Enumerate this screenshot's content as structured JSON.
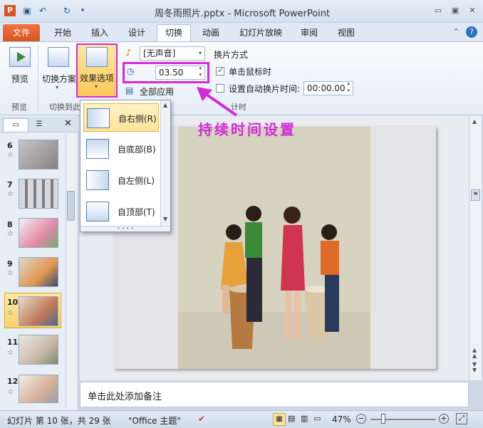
{
  "window": {
    "title": "周冬雨照片.pptx - Microsoft PowerPoint"
  },
  "quick_access": {
    "icons": [
      "powerpoint-logo-icon",
      "save-icon",
      "undo-icon",
      "redo-icon",
      "customize-icon"
    ]
  },
  "window_controls": {
    "minimize": "▭",
    "restore": "▣",
    "close": "✕"
  },
  "tabs": [
    {
      "label": "文件"
    },
    {
      "label": "开始"
    },
    {
      "label": "插入"
    },
    {
      "label": "设计"
    },
    {
      "label": "切换"
    },
    {
      "label": "动画"
    },
    {
      "label": "幻灯片放映"
    },
    {
      "label": "审阅"
    },
    {
      "label": "视图"
    }
  ],
  "ribbon": {
    "preview_label": "预览",
    "transition_scheme_label": "切换方案",
    "effect_options_label": "效果选项",
    "sound_value": "[无声音]",
    "duration_value": "03.50",
    "apply_all_label": "全部应用",
    "advance_title": "换片方式",
    "on_click_label": "单击鼠标时",
    "auto_advance_label": "设置自动换片时间:",
    "auto_advance_value": "00:00.00",
    "group_preview": "预览",
    "group_transition": "切换到此",
    "group_timing": "计时"
  },
  "annotation": {
    "text": "持续时间设置",
    "color": "#d22bd8"
  },
  "effect_menu": {
    "items": [
      {
        "label": "自右侧(R)",
        "selected": true
      },
      {
        "label": "自底部(B)",
        "selected": false
      },
      {
        "label": "自左侧(L)",
        "selected": false
      },
      {
        "label": "自顶部(T)",
        "selected": false
      }
    ]
  },
  "slides": [
    {
      "num": "6"
    },
    {
      "num": "7"
    },
    {
      "num": "8"
    },
    {
      "num": "9"
    },
    {
      "num": "10",
      "active": true
    },
    {
      "num": "11"
    },
    {
      "num": "12"
    }
  ],
  "notes": {
    "placeholder": "单击此处添加备注"
  },
  "status": {
    "slide_info": "幻灯片 第 10 张，共 29 张",
    "theme": "\"Office 主题\"",
    "zoom": "47%"
  }
}
